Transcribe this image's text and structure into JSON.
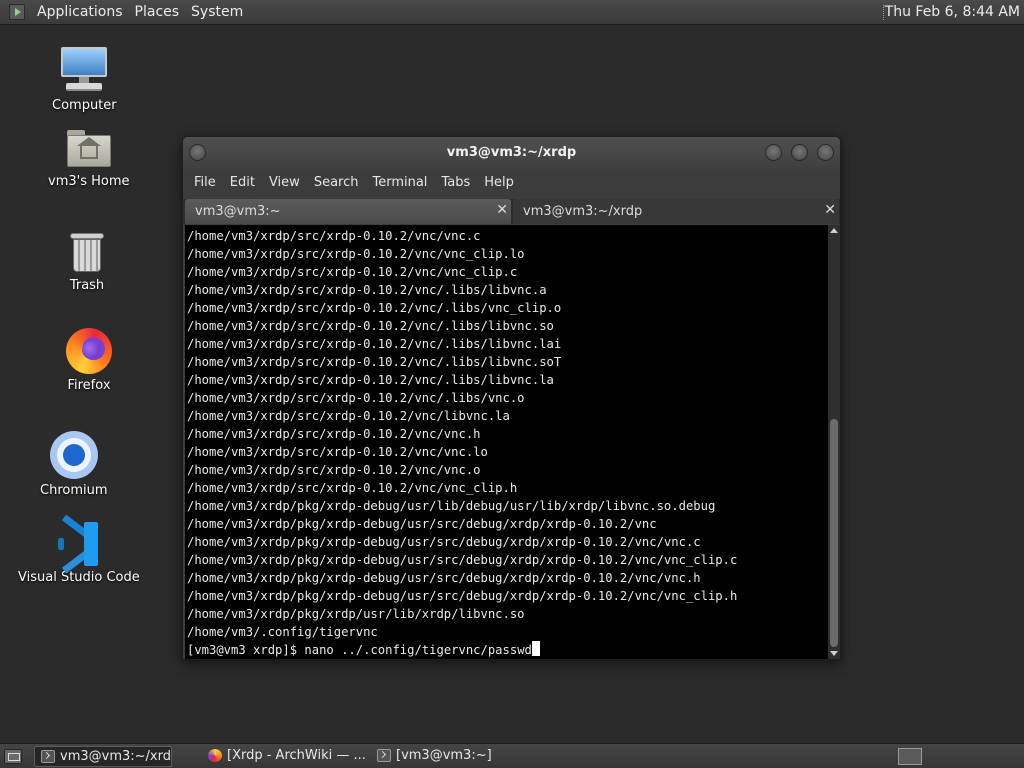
{
  "top_panel": {
    "menus": [
      "Applications",
      "Places",
      "System"
    ],
    "clock": "Thu Feb  6,  8:44 AM"
  },
  "desktop_icons": [
    {
      "label": "Computer",
      "icon": "computer-icon"
    },
    {
      "label": "vm3's Home",
      "icon": "home-folder-icon"
    },
    {
      "label": "Trash",
      "icon": "trash-icon"
    },
    {
      "label": "Firefox",
      "icon": "firefox-icon"
    },
    {
      "label": "Chromium",
      "icon": "chromium-icon"
    },
    {
      "label": "Visual Studio Code",
      "icon": "vscode-icon"
    }
  ],
  "terminal": {
    "title": "vm3@vm3:~/xrdp",
    "menu": [
      "File",
      "Edit",
      "View",
      "Search",
      "Terminal",
      "Tabs",
      "Help"
    ],
    "tabs": [
      {
        "label": "vm3@vm3:~",
        "active": false
      },
      {
        "label": "vm3@vm3:~/xrdp",
        "active": true
      }
    ],
    "lines": [
      "/home/vm3/xrdp/src/xrdp-0.10.2/vnc/vnc.c",
      "/home/vm3/xrdp/src/xrdp-0.10.2/vnc/vnc_clip.lo",
      "/home/vm3/xrdp/src/xrdp-0.10.2/vnc/vnc_clip.c",
      "/home/vm3/xrdp/src/xrdp-0.10.2/vnc/.libs/libvnc.a",
      "/home/vm3/xrdp/src/xrdp-0.10.2/vnc/.libs/vnc_clip.o",
      "/home/vm3/xrdp/src/xrdp-0.10.2/vnc/.libs/libvnc.so",
      "/home/vm3/xrdp/src/xrdp-0.10.2/vnc/.libs/libvnc.lai",
      "/home/vm3/xrdp/src/xrdp-0.10.2/vnc/.libs/libvnc.soT",
      "/home/vm3/xrdp/src/xrdp-0.10.2/vnc/.libs/libvnc.la",
      "/home/vm3/xrdp/src/xrdp-0.10.2/vnc/.libs/vnc.o",
      "/home/vm3/xrdp/src/xrdp-0.10.2/vnc/libvnc.la",
      "/home/vm3/xrdp/src/xrdp-0.10.2/vnc/vnc.h",
      "/home/vm3/xrdp/src/xrdp-0.10.2/vnc/vnc.lo",
      "/home/vm3/xrdp/src/xrdp-0.10.2/vnc/vnc.o",
      "/home/vm3/xrdp/src/xrdp-0.10.2/vnc/vnc_clip.h",
      "/home/vm3/xrdp/pkg/xrdp-debug/usr/lib/debug/usr/lib/xrdp/libvnc.so.debug",
      "/home/vm3/xrdp/pkg/xrdp-debug/usr/src/debug/xrdp/xrdp-0.10.2/vnc",
      "/home/vm3/xrdp/pkg/xrdp-debug/usr/src/debug/xrdp/xrdp-0.10.2/vnc/vnc.c",
      "/home/vm3/xrdp/pkg/xrdp-debug/usr/src/debug/xrdp/xrdp-0.10.2/vnc/vnc_clip.c",
      "/home/vm3/xrdp/pkg/xrdp-debug/usr/src/debug/xrdp/xrdp-0.10.2/vnc/vnc.h",
      "/home/vm3/xrdp/pkg/xrdp-debug/usr/src/debug/xrdp/xrdp-0.10.2/vnc/vnc_clip.h",
      "/home/vm3/xrdp/pkg/xrdp/usr/lib/xrdp/libvnc.so",
      "/home/vm3/.config/tigervnc"
    ],
    "prompt": "[vm3@vm3 xrdp]$ ",
    "command": "nano ../.config/tigervnc/passwd"
  },
  "taskbar": {
    "tasks": [
      {
        "label": "vm3@vm3:~/xrdp",
        "active": true
      },
      {
        "label": "[Xrdp - ArchWiki — ...",
        "active": false
      },
      {
        "label": "[vm3@vm3:~]",
        "active": false
      }
    ]
  }
}
